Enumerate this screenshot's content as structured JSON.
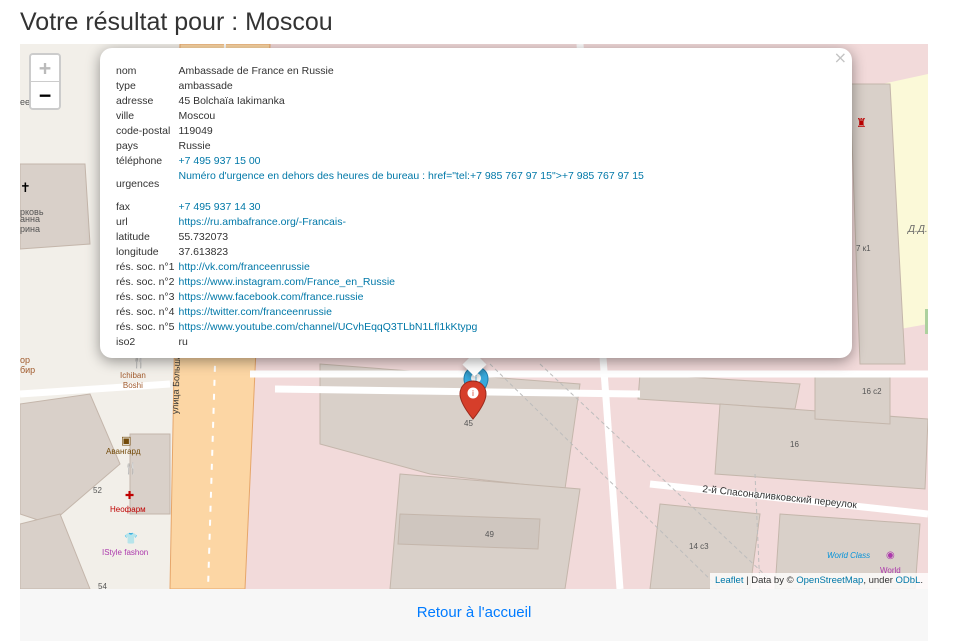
{
  "page": {
    "title": "Votre résultat pour : Moscou",
    "back_link": "Retour à l'accueil"
  },
  "map": {
    "zoom_in": "+",
    "zoom_out": "−",
    "close": "×",
    "street_labels": {
      "bolshaya_yakimanka": "улица Большая Якиманка",
      "spasonalivkovsky": "2-й Спасоналивковский переулок"
    },
    "building_numbers": [
      "45",
      "49",
      "52",
      "54",
      "16",
      "16 с2",
      "14 с3",
      "7 к1"
    ],
    "pois": {
      "ichiban": [
        "Ichiban",
        "Boshi"
      ],
      "avangard": "Авангард",
      "neofarm": "Неофарм",
      "istyle": "IStyle fashon",
      "world_class": "World Class",
      "world": "World"
    },
    "left_edge_texts": [
      "рковь",
      "анна",
      "рина",
      "ор",
      "бир",
      "еев"
    ],
    "right_edge_text": "Д.Д.",
    "attribution": {
      "leaflet": "Leaflet",
      "sep": " | Data by © ",
      "osm": "OpenStreetMap",
      "under": ", under ",
      "odbl": "ODbL",
      "end": "."
    },
    "popup": {
      "rows": [
        {
          "key": "nom",
          "value": "Ambassade de France en Russie"
        },
        {
          "key": "type",
          "value": "ambassade"
        },
        {
          "key": "adresse",
          "value": "45 Bolchaïa Iakimanka"
        },
        {
          "key": "ville",
          "value": "Moscou"
        },
        {
          "key": "code-postal",
          "value": "119049"
        },
        {
          "key": "pays",
          "value": "Russie"
        },
        {
          "key": "téléphone",
          "value": "+7 495 937 15 00"
        },
        {
          "key": "urgences",
          "value": "Numéro d'urgence en dehors des heures de bureau : href=\"tel:+7 985 767 97 15\">+7 985 767 97 15"
        },
        {
          "key": "fax",
          "value": "+7 495 937 14 30"
        },
        {
          "key": "url",
          "value": "https://ru.ambafrance.org/-Francais-"
        },
        {
          "key": "latitude",
          "value": "55.732073"
        },
        {
          "key": "longitude",
          "value": "37.613823"
        },
        {
          "key": "rés. soc. n°1",
          "value": "http://vk.com/franceenrussie"
        },
        {
          "key": "rés. soc. n°2",
          "value": "https://www.instagram.com/France_en_Russie"
        },
        {
          "key": "rés. soc. n°3",
          "value": "https://www.facebook.com/france.russie"
        },
        {
          "key": "rés. soc. n°4",
          "value": "https://twitter.com/franceenrussie"
        },
        {
          "key": "rés. soc. n°5",
          "value": "https://www.youtube.com/channel/UCvhEqqQ3TLbN1Lfl1kKtypg"
        },
        {
          "key": "iso2",
          "value": "ru"
        }
      ]
    }
  },
  "colors": {
    "link": "#0078a8",
    "footer_link": "#007bff",
    "marker_red": "#d63e2a",
    "marker_blue": "#38a9dc",
    "road_orange": "#fcd6a4",
    "building": "#d9d0c9",
    "landuse_pink": "#f2dada"
  }
}
